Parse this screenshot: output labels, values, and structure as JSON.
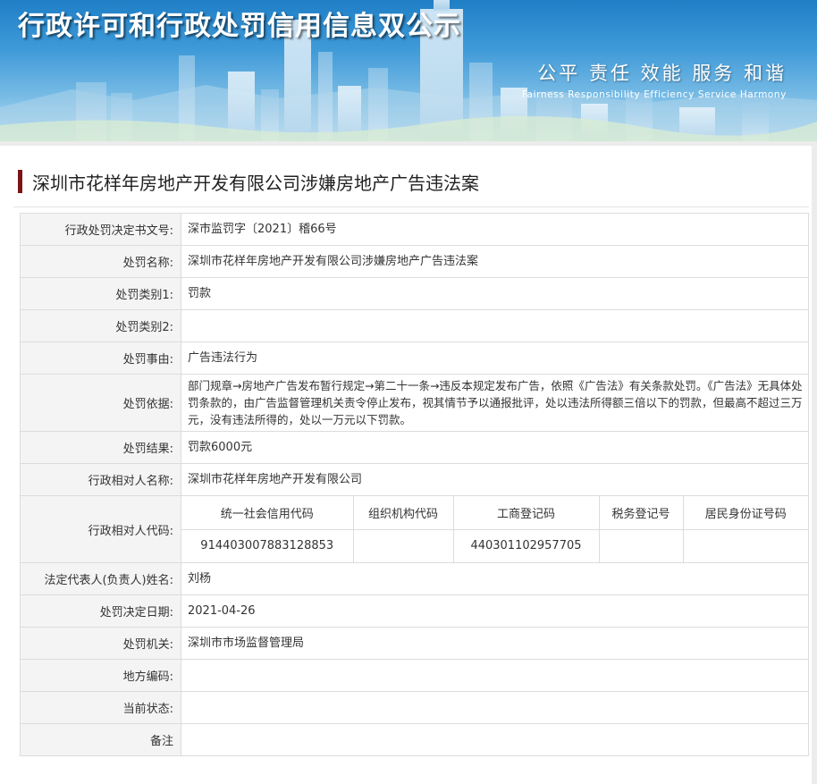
{
  "header": {
    "title": "行政许可和行政处罚信用信息双公示",
    "slogan_cn": "公平  责任  效能  服务  和谐",
    "slogan_en": "Fairness  Responsibility  Efficiency  Service  Harmony"
  },
  "case": {
    "title": "深圳市花样年房地产开发有限公司涉嫌房地产广告违法案"
  },
  "rows": [
    {
      "label": "行政处罚决定书文号:",
      "value": "深市监罚字〔2021〕稽66号"
    },
    {
      "label": "处罚名称:",
      "value": "深圳市花样年房地产开发有限公司涉嫌房地产广告违法案"
    },
    {
      "label": "处罚类别1:",
      "value": "罚款"
    },
    {
      "label": "处罚类别2:",
      "value": ""
    },
    {
      "label": "处罚事由:",
      "value": "广告违法行为"
    },
    {
      "label": "处罚依据:",
      "value": "部门规章→房地产广告发布暂行规定→第二十一条→违反本规定发布广告，依照《广告法》有关条款处罚。《广告法》无具体处罚条款的，由广告监督管理机关责令停止发布，视其情节予以通报批评，处以违法所得额三倍以下的罚款，但最高不超过三万元，没有违法所得的，处以一万元以下罚款。"
    },
    {
      "label": "处罚结果:",
      "value": "罚款6000元"
    },
    {
      "label": "行政相对人名称:",
      "value": "深圳市花样年房地产开发有限公司"
    }
  ],
  "codes": {
    "label": "行政相对人代码:",
    "headers": [
      "统一社会信用代码",
      "组织机构代码",
      "工商登记码",
      "税务登记号",
      "居民身份证号码"
    ],
    "values": [
      "914403007883128853",
      "",
      "440301102957705",
      "",
      ""
    ]
  },
  "rows2": [
    {
      "label": "法定代表人(负责人)姓名:",
      "value": "刘杨"
    },
    {
      "label": "处罚决定日期:",
      "value": "2021-04-26"
    },
    {
      "label": "处罚机关:",
      "value": "深圳市市场监督管理局"
    },
    {
      "label": "地方编码:",
      "value": ""
    },
    {
      "label": "当前状态:",
      "value": ""
    },
    {
      "label": "备注",
      "value": ""
    }
  ]
}
